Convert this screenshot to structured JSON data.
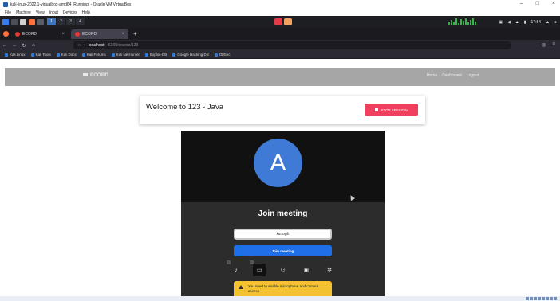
{
  "vbox": {
    "window_title": "kali-linux-2022.1-virtualbox-amd64 [Running] - Oracle VM VirtualBox",
    "menu": [
      "File",
      "Machine",
      "View",
      "Input",
      "Devices",
      "Help"
    ],
    "win_controls": [
      "–",
      "□",
      "×"
    ]
  },
  "kali_panel": {
    "workspaces": [
      "1",
      "2",
      "3",
      "4"
    ],
    "clock": "17:54"
  },
  "browser": {
    "tabs": [
      {
        "label": "ECORD",
        "close": "×"
      },
      {
        "label": "ECORD",
        "close": "×"
      }
    ],
    "new_tab": "+",
    "url_host": "localhost",
    "url_path": ":6200/course/123",
    "bookmarks": [
      "Kali Linux",
      "Kali Tools",
      "Kali Docs",
      "Kali Forums",
      "Kali NetHunter",
      "Exploit-DB",
      "Google Hacking DB",
      "OffSec"
    ]
  },
  "app": {
    "brand": "ECORD",
    "nav_links": [
      "Home",
      "Dashboard",
      "Logout"
    ],
    "welcome_title": "Welcome to 123 - Java",
    "stop_button": "STOP SESSION"
  },
  "meeting": {
    "avatar_letter": "A",
    "join_title": "Join meeting",
    "name_value": "Amogh",
    "join_button": "Join meeting",
    "warning": "You need to enable microphone and camera access"
  },
  "colors": {
    "accent_blue": "#1e6fe8",
    "stop_red": "#f0405e",
    "avatar_blue": "#3f7ad6",
    "warning_yellow": "#f2c230"
  }
}
